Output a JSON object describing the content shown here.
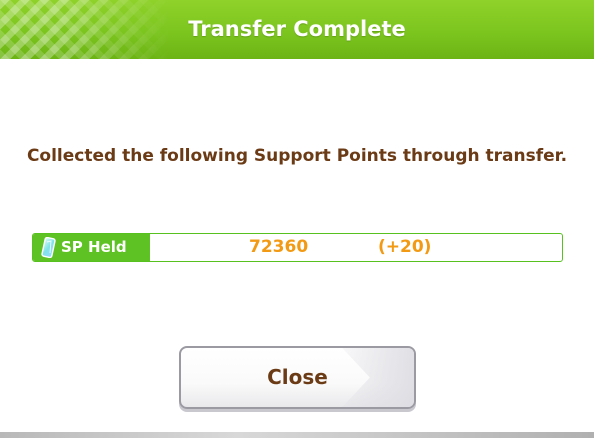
{
  "dialog": {
    "title": "Transfer Complete",
    "message": "Collected the following Support Points through transfer.",
    "sp": {
      "label": "SP Held",
      "value": "72360",
      "delta": "(+20)"
    },
    "close_label": "Close"
  },
  "colors": {
    "header_green": "#7cc51f",
    "tag_green": "#5fc224",
    "message_brown": "#6b3b16",
    "value_orange": "#f29a14"
  },
  "icons": {
    "sp": "sp-card-icon"
  }
}
